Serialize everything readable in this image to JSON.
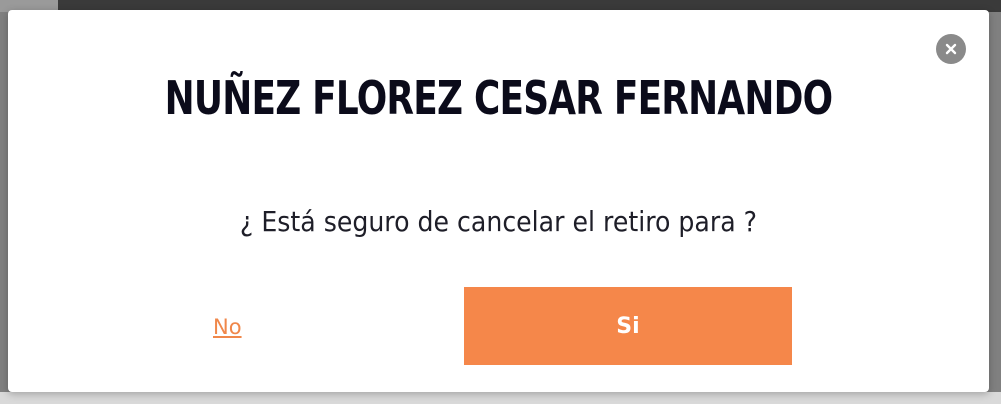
{
  "dialog": {
    "title": "NUÑEZ FLOREZ CESAR FERNANDO",
    "message": "¿ Está seguro de cancelar el retiro para ?",
    "close_icon": "close-icon",
    "no_label": "No",
    "yes_label": "Si"
  },
  "colors": {
    "accent": "#f5874a",
    "link": "#f0874a",
    "title": "#0b0b1a",
    "close_bg": "#8a8a8a"
  }
}
